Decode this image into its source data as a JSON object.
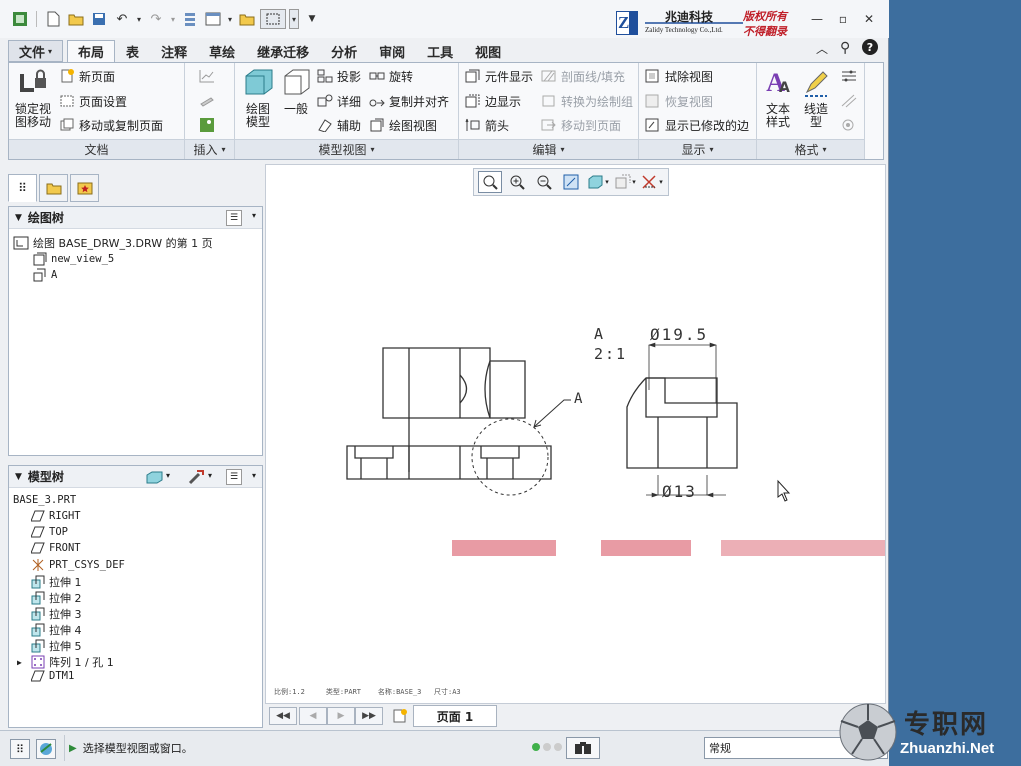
{
  "quick_access": {
    "icons": [
      "app-icon",
      "new-icon",
      "open-icon",
      "save-icon",
      "undo-icon",
      "redo-icon",
      "regenerate-icon",
      "windows-icon",
      "close-window-icon",
      "select-box-icon",
      "customize-icon"
    ]
  },
  "logo": {
    "company": "兆迪科技",
    "company_en": "Zalidy Technology Co.,Ltd.",
    "letter": "Z",
    "slogan1": "版权所有",
    "slogan2": "不得翻录"
  },
  "tabs": [
    "文件",
    "布局",
    "表",
    "注释",
    "草绘",
    "继承迁移",
    "分析",
    "审阅",
    "工具",
    "视图"
  ],
  "ribbon": {
    "doc_group": {
      "lock_label_1": "锁定视",
      "lock_label_2": "图移动",
      "items": [
        "新页面",
        "页面设置",
        "移动或复制页面"
      ],
      "label": "文档"
    },
    "insert_group": {
      "label": "插入"
    },
    "model_view_group": {
      "big1_a": "绘图",
      "big1_b": "模型",
      "big2": "一般",
      "col1": [
        "投影",
        "详细",
        "辅助"
      ],
      "col2": [
        "旋转",
        "复制并对齐",
        "绘图视图"
      ],
      "label": "模型视图"
    },
    "edit_group": {
      "col1": [
        "元件显示",
        "边显示",
        "箭头"
      ],
      "col2": [
        "剖面线/填充",
        "转换为绘制组",
        "移动到页面"
      ],
      "label": "编辑"
    },
    "display_group": {
      "items": [
        "拭除视图",
        "恢复视图",
        "显示已修改的边"
      ],
      "label": "显示"
    },
    "format_group": {
      "big1_a": "文本",
      "big1_b": "样式",
      "big2_a": "线造",
      "big2_b": "型",
      "label": "格式"
    }
  },
  "drawing_tree": {
    "title": "绘图树",
    "items": [
      "绘图 BASE_DRW_3.DRW 的第 1 页",
      "new_view_5",
      "A"
    ]
  },
  "model_tree": {
    "title": "模型树",
    "items": [
      "BASE_3.PRT",
      "RIGHT",
      "TOP",
      "FRONT",
      "PRT_CSYS_DEF",
      "拉伸 1",
      "拉伸 2",
      "拉伸 3",
      "拉伸 4",
      "拉伸 5",
      "阵列 1 / 孔 1",
      "DTM1"
    ]
  },
  "drawing": {
    "detail_label": "A",
    "scale": "2:1",
    "dim1": "Ø19.5",
    "dim2": "Ø13",
    "callout": "A",
    "footer": "比例:1.2     类型:PART    名称:BASE_3   尺寸:A3"
  },
  "pager": {
    "page_label": "页面 1"
  },
  "status": {
    "message": "选择模型视图或窗口。",
    "filter": "常规"
  },
  "watermark": {
    "cn": "专职网",
    "url": "Zhuanzhi.Net"
  },
  "colors": {
    "blur": "#e07a86",
    "accent": "#1f5ea8"
  }
}
